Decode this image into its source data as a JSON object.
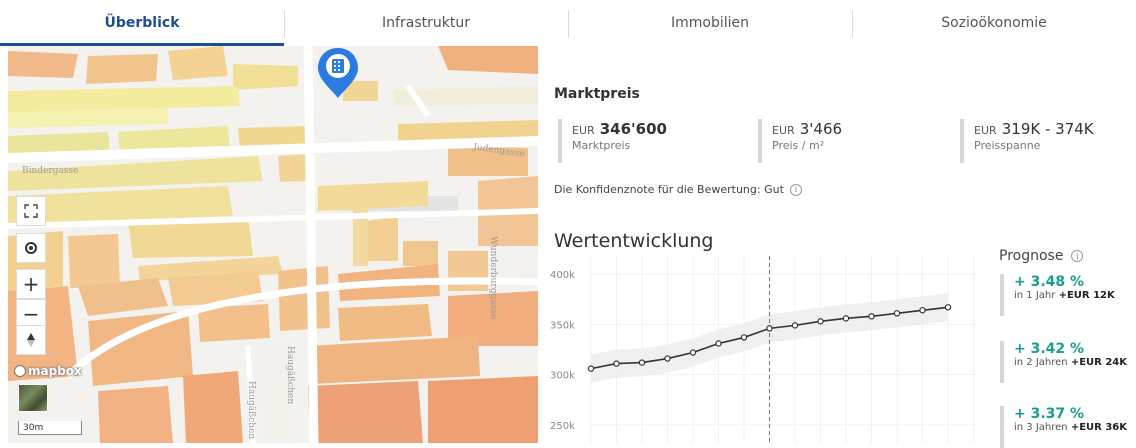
{
  "tabs": [
    {
      "label": "Überblick",
      "active": true
    },
    {
      "label": "Infrastruktur",
      "active": false
    },
    {
      "label": "Immobilien",
      "active": false
    },
    {
      "label": "Sozioökonomie",
      "active": false
    }
  ],
  "map": {
    "streets": [
      "Bindergasse",
      "Judengasse",
      "Wunderburggasse",
      "Haugäßchen",
      "Haugäßchen"
    ],
    "attribution": "mapbox",
    "scale": "30m",
    "controls": [
      "fullscreen-icon",
      "locate-icon",
      "zoom-in-icon",
      "zoom-out-icon",
      "compass-icon"
    ],
    "pin_icon": "building-icon"
  },
  "market": {
    "title": "Marktpreis",
    "kpis": [
      {
        "currency": "EUR",
        "value": "346'600",
        "label": "Marktpreis"
      },
      {
        "currency": "EUR",
        "value": "3'466",
        "label": "Preis / m²"
      },
      {
        "currency": "EUR",
        "value": "319K - 374K",
        "label": "Preisspanne"
      }
    ],
    "confidence": "Die Konfidenznote für die Bewertung: Gut"
  },
  "chart_title": "Wertentwicklung",
  "chart_data": {
    "type": "line",
    "x": [
      1,
      2,
      3,
      4,
      5,
      6,
      7,
      8,
      9,
      10,
      11,
      12,
      13,
      14,
      15
    ],
    "values": [
      306,
      311,
      312,
      316,
      322,
      331,
      337,
      346,
      349,
      353,
      356,
      358,
      361,
      364,
      367
    ],
    "yticks": [
      "400k",
      "350k",
      "300k",
      "250k"
    ],
    "ylim": [
      232,
      418
    ],
    "today_index": 7,
    "grid": true,
    "line_color": "#333333",
    "band_color": "#ececec"
  },
  "forecast": {
    "title": "Prognose",
    "items": [
      {
        "pct": "+ 3.48 %",
        "period": "in 1 Jahr",
        "amount": "+EUR 12K"
      },
      {
        "pct": "+ 3.42 %",
        "period": "in 2 Jahren",
        "amount": "+EUR 24K"
      },
      {
        "pct": "+ 3.37 %",
        "period": "in 3 Jahren",
        "amount": "+EUR 36K"
      }
    ],
    "accent": "#1a9e8f"
  }
}
